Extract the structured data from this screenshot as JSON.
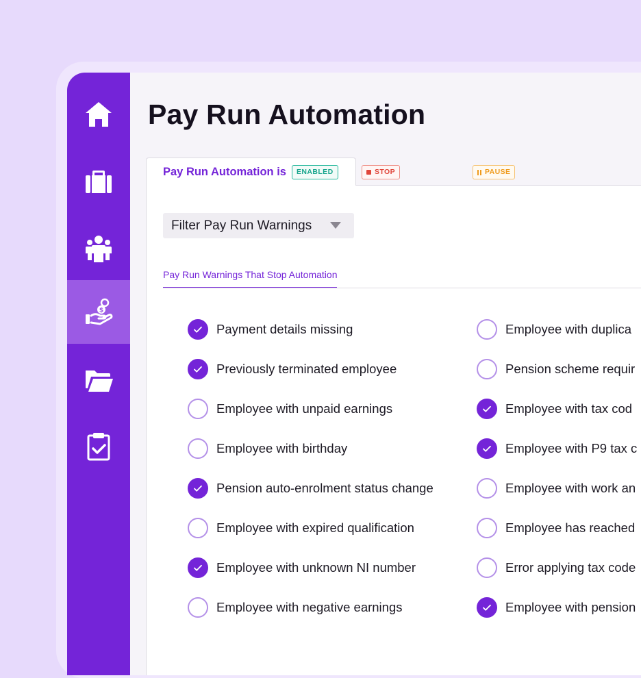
{
  "page": {
    "title": "Pay Run Automation"
  },
  "sidebar": {
    "items": [
      {
        "icon": "home-icon",
        "active": false
      },
      {
        "icon": "briefcase-icon",
        "active": false
      },
      {
        "icon": "people-icon",
        "active": false
      },
      {
        "icon": "hand-coins-icon",
        "active": true
      },
      {
        "icon": "folder-icon",
        "active": false
      },
      {
        "icon": "clipboard-check-icon",
        "active": false
      }
    ]
  },
  "automation": {
    "status_label": "Pay Run Automation is",
    "status_badge": "ENABLED",
    "stop_label": "STOP",
    "pause_label": "PAUSE"
  },
  "filter": {
    "label": "Filter Pay Run Warnings"
  },
  "section_tab": {
    "label": "Pay Run Warnings That Stop Automation"
  },
  "warnings": {
    "column1": [
      {
        "label": "Payment details missing",
        "checked": true
      },
      {
        "label": "Previously terminated employee",
        "checked": true
      },
      {
        "label": "Employee with unpaid earnings",
        "checked": false
      },
      {
        "label": "Employee with birthday",
        "checked": false
      },
      {
        "label": "Pension auto-enrolment status change",
        "checked": true
      },
      {
        "label": "Employee with expired qualification",
        "checked": false
      },
      {
        "label": "Employee with unknown NI number",
        "checked": true
      },
      {
        "label": "Employee with negative earnings",
        "checked": false
      }
    ],
    "column2": [
      {
        "label": "Employee with duplica",
        "checked": false
      },
      {
        "label": "Pension scheme requir",
        "checked": false
      },
      {
        "label": "Employee with tax cod",
        "checked": true
      },
      {
        "label": "Employee with P9 tax c",
        "checked": true
      },
      {
        "label": "Employee with work an",
        "checked": false
      },
      {
        "label": "Employee has reached",
        "checked": false
      },
      {
        "label": "Error applying tax code",
        "checked": false
      },
      {
        "label": "Employee with pension",
        "checked": true
      }
    ]
  },
  "colors": {
    "brand": "#7424d8",
    "sidebar_active": "#9b5ae4",
    "enabled": "#17a58c",
    "stop": "#e0453a",
    "pause": "#ef9a1b"
  }
}
